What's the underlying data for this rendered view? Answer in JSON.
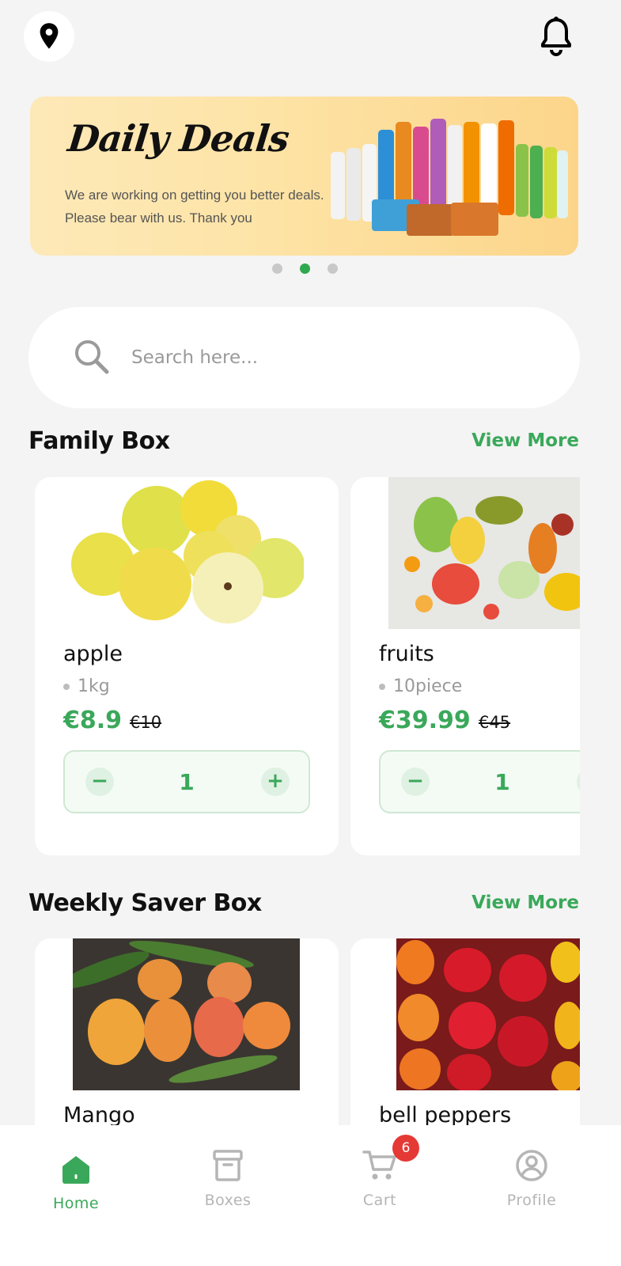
{
  "banner": {
    "title": "Daily Deals",
    "line1": "We are working on getting you better deals.",
    "line2": "Please bear with us. Thank you",
    "slides": 3,
    "active_slide": 2
  },
  "search": {
    "placeholder": "Search here..."
  },
  "sections": [
    {
      "title": "Family Box",
      "view_more": "View More",
      "items": [
        {
          "name": "apple",
          "qty": "1kg",
          "price": "€8.9",
          "old_price": "€10",
          "count": "1"
        },
        {
          "name": "fruits",
          "qty": "10piece",
          "price": "€39.99",
          "old_price": "€45",
          "count": "1"
        }
      ]
    },
    {
      "title": "Weekly Saver Box",
      "view_more": "View More",
      "items": [
        {
          "name": "Mango"
        },
        {
          "name": "bell peppers"
        }
      ]
    }
  ],
  "stepper": {
    "minus": "−",
    "plus": "+"
  },
  "nav": {
    "home": "Home",
    "boxes": "Boxes",
    "cart": "Cart",
    "profile": "Profile",
    "cart_badge": "6"
  },
  "colors": {
    "accent": "#3aa85a",
    "badge": "#e53935",
    "background": "#f4f4f4"
  },
  "icons": [
    "location-pin-icon",
    "bell-icon",
    "search-icon",
    "home-icon",
    "box-icon",
    "cart-icon",
    "profile-icon"
  ]
}
